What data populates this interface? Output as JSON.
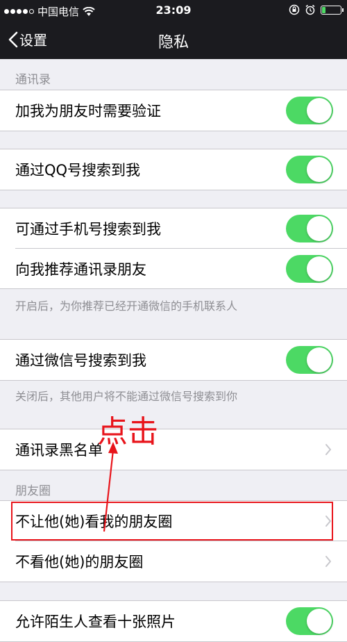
{
  "status_bar": {
    "carrier": "中国电信",
    "time": "23:09",
    "signal_bars": 4,
    "signal_total": 5,
    "battery_level": 0.2
  },
  "nav": {
    "back_label": "设置",
    "title": "隐私"
  },
  "sections": {
    "contacts_header": "通讯录",
    "moments_header": "朋友圈"
  },
  "rows": {
    "verify_friend": "加我为朋友时需要验证",
    "search_by_qq": "通过QQ号搜索到我",
    "search_by_phone": "可通过手机号搜索到我",
    "recommend_contacts": "向我推荐通讯录朋友",
    "search_by_wechat_id": "通过微信号搜索到我",
    "blacklist": "通讯录黑名单",
    "hide_my_moments": "不让他(她)看我的朋友圈",
    "dont_view_moments": "不看他(她)的朋友圈",
    "stranger_photos": "允许陌生人查看十张照片"
  },
  "footnotes": {
    "recommend_note": "开启后，为你推荐已经开通微信的手机联系人",
    "wechat_id_note": "关闭后，其他用户将不能通过微信号搜索到你"
  },
  "toggles": {
    "verify_friend": true,
    "search_by_qq": true,
    "search_by_phone": true,
    "recommend_contacts": true,
    "search_by_wechat_id": true,
    "stranger_photos": true
  },
  "annotation": {
    "text": "点击",
    "color": "#e8141b"
  },
  "colors": {
    "toggle_on": "#4cd964",
    "nav_bg": "#1b1b1f",
    "page_bg": "#efeff4"
  }
}
